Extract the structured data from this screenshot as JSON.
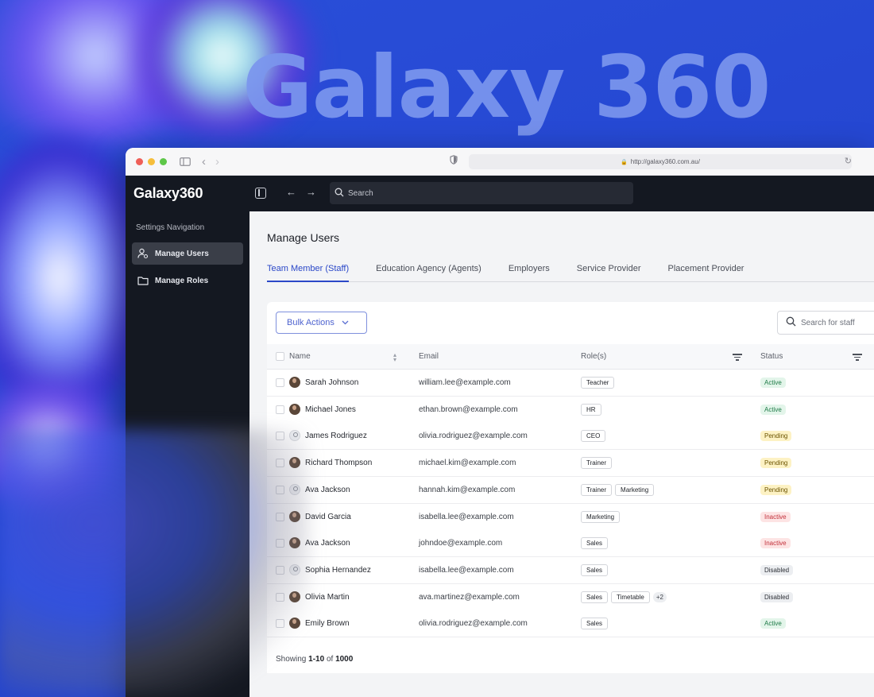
{
  "hero": {
    "title": "Galaxy 360"
  },
  "browser": {
    "url": "http://galaxy360.com.au/",
    "traffic_colors": [
      "#ef5f58",
      "#f6be3b",
      "#5ec748"
    ]
  },
  "app": {
    "brand": "Galaxy360",
    "search_placeholder": "Search"
  },
  "sidebar": {
    "heading": "Settings Navigation",
    "items": [
      {
        "label": "Manage Users",
        "icon": "user-gear-icon",
        "active": true
      },
      {
        "label": "Manage Roles",
        "icon": "folder-icon",
        "active": false
      }
    ]
  },
  "main": {
    "title": "Manage Users",
    "tabs": [
      {
        "label": "Team Member (Staff)",
        "active": true
      },
      {
        "label": "Education Agency (Agents)",
        "active": false
      },
      {
        "label": "Employers",
        "active": false
      },
      {
        "label": "Service Provider",
        "active": false
      },
      {
        "label": "Placement Provider",
        "active": false
      }
    ],
    "bulk_actions_label": "Bulk Actions",
    "staff_search_placeholder": "Search for staff",
    "columns": [
      "Name",
      "Email",
      "Role(s)",
      "Status"
    ],
    "rows": [
      {
        "name": "Sarah Johnson",
        "email": "william.lee@example.com",
        "roles": [
          "Teacher"
        ],
        "more": "",
        "status": "Active",
        "avatar": "photo"
      },
      {
        "name": "Michael Jones",
        "email": "ethan.brown@example.com",
        "roles": [
          "HR"
        ],
        "more": "",
        "status": "Active",
        "avatar": "photo"
      },
      {
        "name": "James Rodriguez",
        "email": "olivia.rodriguez@example.com",
        "roles": [
          "CEO"
        ],
        "more": "",
        "status": "Pending",
        "avatar": "placeholder"
      },
      {
        "name": "Richard Thompson",
        "email": "michael.kim@example.com",
        "roles": [
          "Trainer"
        ],
        "more": "",
        "status": "Pending",
        "avatar": "photo"
      },
      {
        "name": "Ava Jackson",
        "email": "hannah.kim@example.com",
        "roles": [
          "Trainer",
          "Marketing"
        ],
        "more": "",
        "status": "Pending",
        "avatar": "placeholder"
      },
      {
        "name": "David Garcia",
        "email": "isabella.lee@example.com",
        "roles": [
          "Marketing"
        ],
        "more": "",
        "status": "Inactive",
        "avatar": "photo"
      },
      {
        "name": "Ava Jackson",
        "email": "johndoe@example.com",
        "roles": [
          "Sales"
        ],
        "more": "",
        "status": "Inactive",
        "avatar": "photo"
      },
      {
        "name": "Sophia Hernandez",
        "email": "isabella.lee@example.com",
        "roles": [
          "Sales"
        ],
        "more": "",
        "status": "Disabled",
        "avatar": "placeholder"
      },
      {
        "name": "Olivia Martin",
        "email": "ava.martinez@example.com",
        "roles": [
          "Sales",
          "Timetable"
        ],
        "more": "+2",
        "status": "Disabled",
        "avatar": "photo"
      },
      {
        "name": "Emily Brown",
        "email": "olivia.rodriguez@example.com",
        "roles": [
          "Sales"
        ],
        "more": "",
        "status": "Active",
        "avatar": "photo"
      }
    ],
    "status_colors": {
      "Active": {
        "bg": "#e3f5ea",
        "fg": "#1e7a47"
      },
      "Pending": {
        "bg": "#fdf2c4",
        "fg": "#6b5300"
      },
      "Inactive": {
        "bg": "#fde4e4",
        "fg": "#c2303a"
      },
      "Disabled": {
        "bg": "#eceef1",
        "fg": "#2c2f36"
      }
    },
    "footer": {
      "prefix": "Showing",
      "range": "1-10",
      "of": "of",
      "total": "1000"
    }
  }
}
